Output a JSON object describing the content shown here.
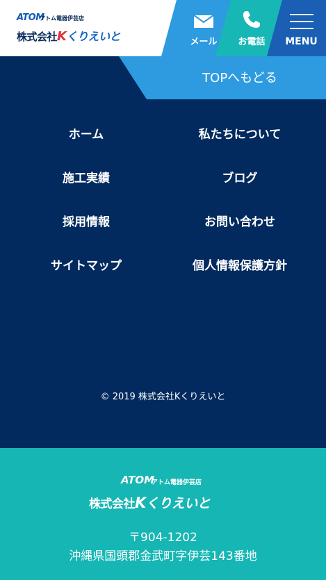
{
  "header": {
    "logo": {
      "atom": "ATOM",
      "atom_sub": "アトム電器伊芸店",
      "company": "株式会社",
      "k": "K",
      "brand": "くりえいと"
    },
    "mail_label": "メール",
    "tel_label": "お電話",
    "menu_label": "MENU",
    "icons": {
      "mail": "mail-icon",
      "tel": "phone-icon",
      "menu": "hamburger-icon"
    }
  },
  "top_back_label": "TOPへもどる",
  "nav": {
    "items": [
      "ホーム",
      "私たちについて",
      "施工実績",
      "ブログ",
      "採用情報",
      "お問い合わせ",
      "サイトマップ",
      "個人情報保護方針"
    ]
  },
  "copyright": "© 2019 株式会社Kくりえいと",
  "footer": {
    "logo": {
      "atom": "ATOM",
      "atom_sub": "アトム電器伊芸店",
      "company": "株式会社",
      "k": "K",
      "brand": "くりえいと"
    },
    "postal": "〒904-1202",
    "address": "沖縄県国頭郡金武町字伊芸143番地"
  },
  "colors": {
    "navy": "#022a5e",
    "sky": "#2e9be0",
    "teal": "#17b7b6",
    "blue": "#1a5fb4"
  }
}
